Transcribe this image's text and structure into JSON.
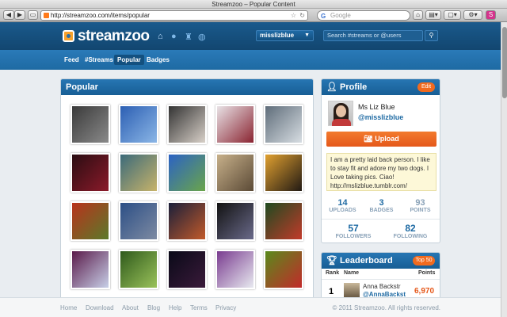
{
  "browser": {
    "window_title": "Streamzoo – Popular Content",
    "url": "http://streamzoo.com/items/popular",
    "search_placeholder": "Google"
  },
  "site": {
    "logo_text": "streamzoo",
    "user_menu": "misslizblue",
    "search_placeholder": "Search #streams or @users"
  },
  "subnav": [
    "Feed",
    "#Streams",
    "Popular",
    "Badges"
  ],
  "popular": {
    "title": "Popular",
    "photos": [
      [
        "#3a3a3a",
        "#8a8a8a"
      ],
      [
        "#2c5fb3",
        "#8bb6e6"
      ],
      [
        "#333",
        "#d8d0c8"
      ],
      [
        "#e8e2e6",
        "#8a2431"
      ],
      [
        "#5f6d7a",
        "#d7dde2"
      ],
      [
        "#2a0d12",
        "#8b1a2a"
      ],
      [
        "#3b6a7a",
        "#c7b36a"
      ],
      [
        "#2b62c4",
        "#6aa54a"
      ],
      [
        "#c7b08a",
        "#5b4a36"
      ],
      [
        "#e0a030",
        "#221a14"
      ],
      [
        "#b8321c",
        "#5b7a2a"
      ],
      [
        "#2c4f86",
        "#7d8aa2"
      ],
      [
        "#1a1f3a",
        "#c25a2a"
      ],
      [
        "#121212",
        "#6a6a8a"
      ],
      [
        "#1f4a20",
        "#c23a2a"
      ],
      [
        "#5a1a4a",
        "#c8d0e8"
      ],
      [
        "#2f5a1c",
        "#9ac25a"
      ],
      [
        "#0a0a18",
        "#3a1a3a"
      ],
      [
        "#7a3c90",
        "#e8eaf0"
      ],
      [
        "#5a8a1c",
        "#c22a2a"
      ]
    ]
  },
  "profile": {
    "title": "Profile",
    "edit_label": "Edit",
    "name": "Ms Liz Blue",
    "handle": "@misslizblue",
    "upload_label": "Upload",
    "bio": "I am a pretty laid back person. I like to stay fit and adore my two dogs. I Love taking pics. Ciao! http://mslizblue.tumblr.com/",
    "stats": [
      {
        "value": "14",
        "label": "UPLOADS"
      },
      {
        "value": "3",
        "label": "BADGES"
      },
      {
        "value": "93",
        "label": "POINTS"
      },
      {
        "value": "57",
        "label": "FOLLOWERS"
      },
      {
        "value": "82",
        "label": "FOLLOWING"
      }
    ]
  },
  "leaderboard": {
    "title": "Leaderboard",
    "filter": "Top 50",
    "columns": [
      "Rank",
      "Name",
      "Points"
    ],
    "rows": [
      {
        "rank": "1",
        "name": "Anna Backstr",
        "handle": "@AnnaBackst",
        "points": "6,970"
      }
    ]
  },
  "footer": {
    "links": [
      "Home",
      "Download",
      "About",
      "Blog",
      "Help",
      "Terms",
      "Privacy"
    ],
    "copyright": "© 2011 Streamzoo. All rights reserved."
  }
}
